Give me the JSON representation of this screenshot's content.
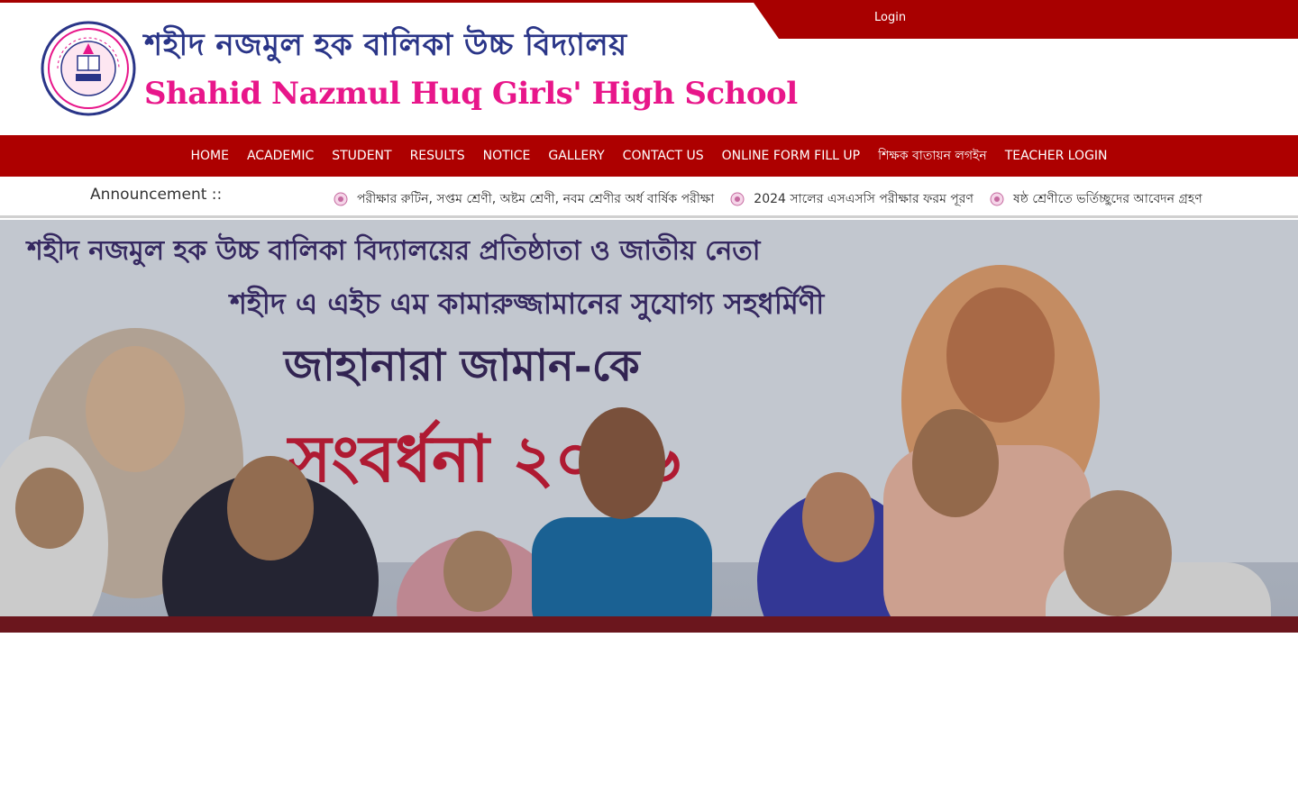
{
  "header": {
    "login_label": "Login",
    "school_name_bn": "শহীদ নজমুল হক বালিকা উচ্চ বিদ্যালয়",
    "school_name_en": "Shahid Nazmul Huq Girls' High School",
    "logo_icon": "school-crest-icon"
  },
  "nav": {
    "items": [
      {
        "label": "HOME"
      },
      {
        "label": "ACADEMIC"
      },
      {
        "label": "STUDENT"
      },
      {
        "label": "RESULTS"
      },
      {
        "label": "NOTICE"
      },
      {
        "label": "GALLERY"
      },
      {
        "label": "CONTACT US"
      },
      {
        "label": "ONLINE FORM FILL UP"
      },
      {
        "label": "শিক্ষক বাতায়ন লগইন"
      },
      {
        "label": "TEACHER LOGIN"
      }
    ]
  },
  "announcement": {
    "label": "Announcement ::",
    "items": [
      {
        "text": "পরীক্ষার রুটিন, সপ্তম শ্রেণী, অষ্টম শ্রেণী, নবম শ্রেণীর অর্ধ বার্ষিক পরীক্ষা"
      },
      {
        "text": "2024 সালের এসএসসি পরীক্ষার ফরম পূরণ"
      },
      {
        "text": "ষষ্ঠ শ্রেণীতে ভর্তিচ্ছুদের আবেদন গ্রহণ"
      }
    ]
  },
  "banner": {
    "line1": "শহীদ নজমুল হক উচ্চ বালিকা বিদ্যালয়ের প্রতিষ্ঠাতা ও জাতীয় নেতা",
    "line2": "শহীদ এ এইচ এম কামারুজ্জামানের সুযোগ্য সহধর্মিণী",
    "line3": "জাহানারা জামান-কে",
    "line4": "সংবর্ধনা ২০১৬"
  },
  "colors": {
    "primary_red": "#ad0000",
    "brand_blue": "#2a3588",
    "brand_pink": "#e8168a"
  }
}
